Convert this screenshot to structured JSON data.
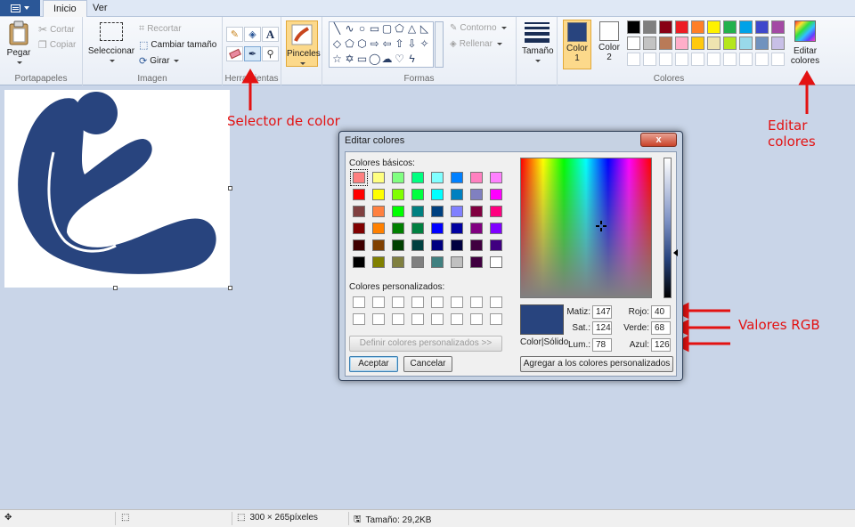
{
  "tabs": [
    {
      "label": "Inicio"
    },
    {
      "label": "Ver"
    }
  ],
  "ribbon": {
    "portapapeles": {
      "paste": "Pegar",
      "cut": "Cortar",
      "copy": "Copiar",
      "label": "Portapapeles"
    },
    "imagen": {
      "select": "Seleccionar",
      "crop": "Recortar",
      "resize": "Cambiar tamaño",
      "rotate": "Girar",
      "label": "Imagen"
    },
    "herramientas": {
      "label": "Herramientas"
    },
    "brushes": {
      "label": "Pinceles"
    },
    "formas": {
      "outline": "Contorno",
      "fill": "Rellenar",
      "label": "Formas"
    },
    "size": {
      "label": "Tamaño"
    },
    "colores": {
      "color1": "Color",
      "color1_n": "1",
      "color2": "Color",
      "color2_n": "2",
      "edit": "Editar",
      "edit2": "colores",
      "label": "Colores",
      "color1_hex": "#28447e",
      "color2_hex": "#ffffff"
    },
    "palette_row1": [
      "#000000",
      "#7f7f7f",
      "#880015",
      "#ed1c24",
      "#ff7f27",
      "#fff200",
      "#22b14c",
      "#00a2e8",
      "#3f48cc",
      "#a349a4"
    ],
    "palette_row2": [
      "#ffffff",
      "#c3c3c3",
      "#b97a57",
      "#ffaec9",
      "#ffc90e",
      "#efe4b0",
      "#b5e61d",
      "#99d9ea",
      "#7092be",
      "#c8bfe7"
    ]
  },
  "annotations": {
    "selector": "Selector de color",
    "edit_colors": "Editar colores",
    "rgb": "Valores RGB"
  },
  "dialog": {
    "title": "Editar colores",
    "close": "x",
    "basic_label": "Colores básicos:",
    "custom_label": "Colores personalizados:",
    "define_button": "Definir colores personalizados >>",
    "ok": "Aceptar",
    "cancel": "Cancelar",
    "add_button": "Agregar a los colores personalizados",
    "preview_label": "Color|Sólido",
    "fields": {
      "hue_label": "Matiz:",
      "hue": "147",
      "sat_label": "Sat.:",
      "sat": "124",
      "lum_label": "Lum.:",
      "lum": "78",
      "red_label": "Rojo:",
      "red": "40",
      "green_label": "Verde:",
      "green": "68",
      "blue_label": "Azul:",
      "blue": "126"
    },
    "basic_colors": [
      [
        "#ff8080",
        "#ffff80",
        "#80ff80",
        "#00ff80",
        "#80ffff",
        "#0080ff",
        "#ff80c0",
        "#ff80ff"
      ],
      [
        "#ff0000",
        "#ffff00",
        "#80ff00",
        "#00ff40",
        "#00ffff",
        "#0080c0",
        "#8080c0",
        "#ff00ff"
      ],
      [
        "#804040",
        "#ff8040",
        "#00ff00",
        "#008080",
        "#004080",
        "#8080ff",
        "#800040",
        "#ff0080"
      ],
      [
        "#800000",
        "#ff8000",
        "#008000",
        "#008040",
        "#0000ff",
        "#0000a0",
        "#800080",
        "#8000ff"
      ],
      [
        "#400000",
        "#804000",
        "#004000",
        "#004040",
        "#000080",
        "#000040",
        "#400040",
        "#400080"
      ],
      [
        "#000000",
        "#808000",
        "#808040",
        "#808080",
        "#408080",
        "#c0c0c0",
        "#400040",
        "#ffffff"
      ]
    ]
  },
  "status": {
    "dimensions": "300 × 265píxeles",
    "size": "Tamaño: 29,2KB"
  }
}
